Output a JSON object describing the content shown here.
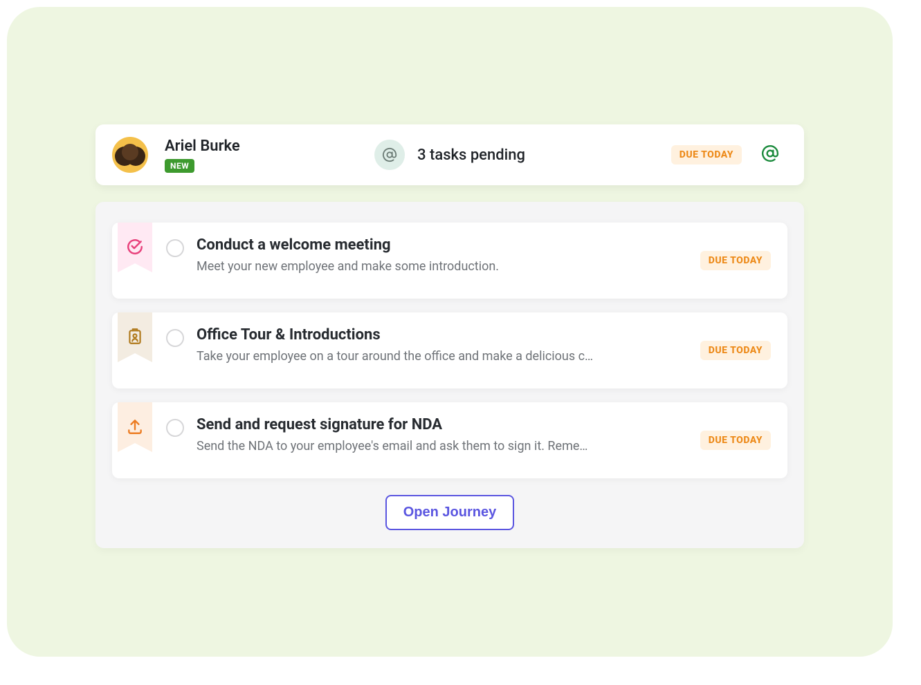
{
  "header": {
    "name": "Ariel Burke",
    "badge": "NEW",
    "tasks_pending": "3 tasks pending",
    "due_label": "DUE TODAY"
  },
  "tasks": [
    {
      "icon": "check-circle-icon",
      "ribbon": "pink",
      "title": "Conduct a welcome meeting",
      "desc": "Meet your new employee and make some introduction.",
      "due": "DUE TODAY"
    },
    {
      "icon": "id-badge-icon",
      "ribbon": "tan",
      "title": "Office Tour & Introductions",
      "desc": "Take your employee on a tour around the office and make a delicious c…",
      "due": "DUE TODAY"
    },
    {
      "icon": "upload-icon",
      "ribbon": "peach",
      "title": "Send and request signature for NDA",
      "desc": "Send the NDA to your employee's email and ask them to sign it. Reme…",
      "due": "DUE TODAY"
    }
  ],
  "cta": {
    "label": "Open Journey"
  },
  "colors": {
    "accent_purple": "#5a55e0",
    "due_orange": "#ed8a19",
    "badge_green": "#3d9a2e"
  }
}
